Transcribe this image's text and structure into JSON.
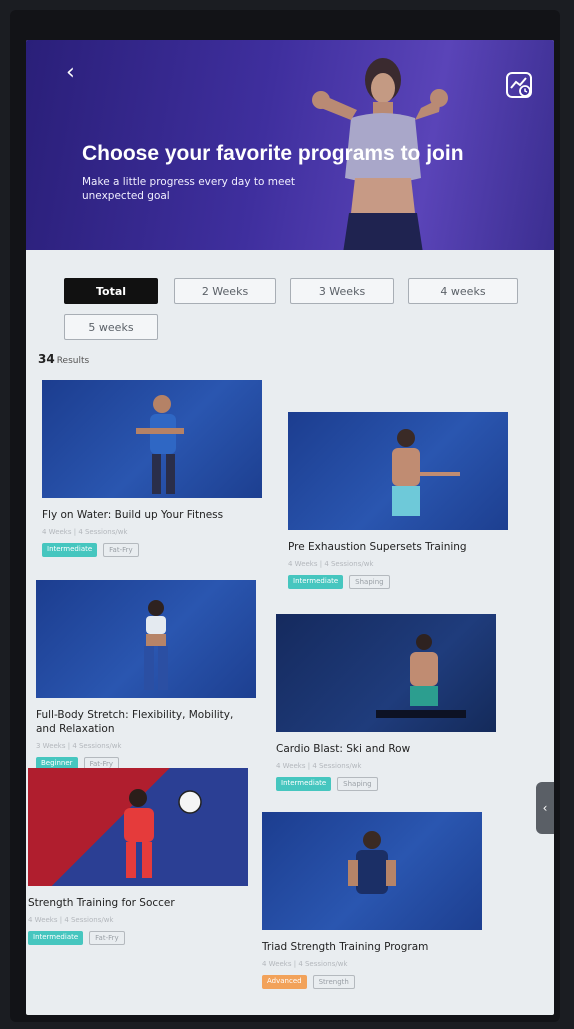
{
  "header": {
    "back_icon": "chevron-left-icon",
    "history_icon": "chart-history-icon",
    "title": "Choose your favorite programs to join",
    "subtitle": "Make a little progress every day to meet unexpected goal"
  },
  "filters": {
    "selected": "Total",
    "chips": [
      "Total",
      "2 Weeks",
      "3 Weeks",
      "4 weeks",
      "5 weeks"
    ]
  },
  "results": {
    "count": "34",
    "label": "Results"
  },
  "programs": [
    {
      "title": "Fly on Water: Build up Your Fitness",
      "meta": "4 Weeks | 4 Sessions/wk",
      "level": "Intermediate",
      "category": "Fat-Fry",
      "level_color": "#46c6bf"
    },
    {
      "title": "Pre Exhaustion Supersets Training",
      "meta": "4 Weeks | 4 Sessions/wk",
      "level": "Intermediate",
      "category": "Shaping",
      "level_color": "#46c6bf"
    },
    {
      "title": "Full-Body Stretch: Flexibility, Mobility, and Relaxation",
      "meta": "3 Weeks | 4 Sessions/wk",
      "level": "Beginner",
      "category": "Fat-Fry",
      "level_color": "#46c6bf"
    },
    {
      "title": "Cardio Blast: Ski and Row",
      "meta": "4 Weeks | 4 Sessions/wk",
      "level": "Intermediate",
      "category": "Shaping",
      "level_color": "#46c6bf"
    },
    {
      "title": "Strength Training for Soccer",
      "meta": "4 Weeks | 4 Sessions/wk",
      "level": "Intermediate",
      "category": "Fat-Fry",
      "level_color": "#46c6bf"
    },
    {
      "title": "Triad Strength Training Program",
      "meta": "4 Weeks | 4 Sessions/wk",
      "level": "Advanced",
      "category": "Strength",
      "level_color": "#f2a25a"
    }
  ],
  "side_handle_icon": "chevron-left-icon"
}
